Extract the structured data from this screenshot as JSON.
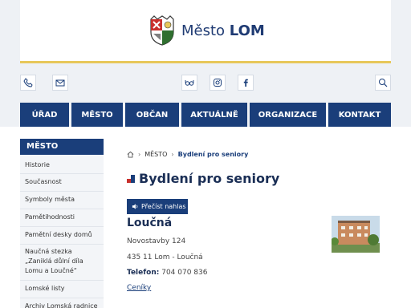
{
  "header": {
    "site_name_prefix": "Město",
    "site_name_bold": "LOM"
  },
  "toolbar": {
    "left_icons": [
      "phone-icon",
      "mail-icon"
    ],
    "center_icons": [
      "glasses-icon",
      "instagram-icon",
      "facebook-icon"
    ],
    "right_icons": [
      "search-icon"
    ]
  },
  "nav": {
    "items": [
      "ÚŘAD",
      "MĚSTO",
      "OBČAN",
      "AKTUÁLNĚ",
      "ORGANIZACE",
      "KONTAKT"
    ]
  },
  "sidebar": {
    "title": "MĚSTO",
    "items": [
      "Historie",
      "Současnost",
      "Symboly města",
      "Pamětihodnosti",
      "Pamětní desky domů",
      "Naučná stezka „Zaniklá důlní díla Lomu a Loučné“",
      "Lomské listy",
      "Archiv Lomská radnice"
    ]
  },
  "breadcrumb": {
    "section": "MĚSTO",
    "current": "Bydlení pro seniory"
  },
  "main": {
    "title": "Bydlení pro seniory",
    "read_aloud": "Přečíst nahlas",
    "subtitle": "Loučná",
    "address_line1": "Novostavby 124",
    "address_line2": "435 11 Lom - Loučná",
    "phone_label": "Telefon:",
    "phone_value": "704 070 836",
    "pricing_link": "Ceníky"
  }
}
